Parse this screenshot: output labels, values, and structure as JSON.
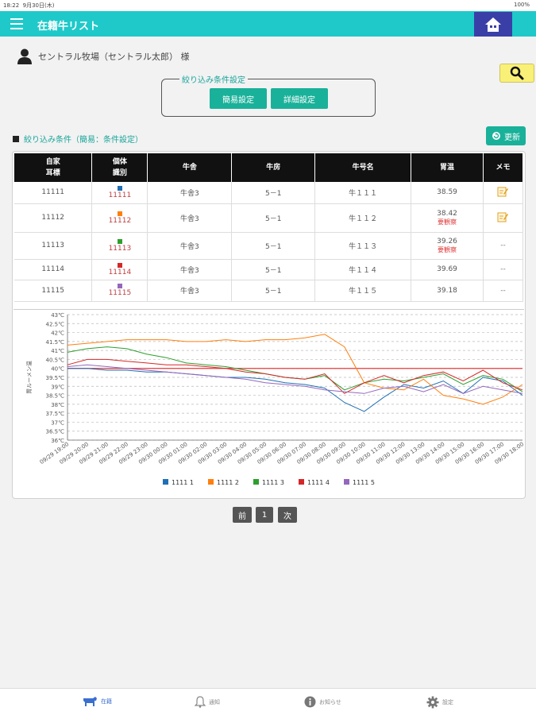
{
  "status": {
    "time": "18:22",
    "date": "9月30日(木)",
    "battery": "100%"
  },
  "header": {
    "title": "在籍牛リスト"
  },
  "user": {
    "name": "セントラル牧場（セントラル太郎） 様"
  },
  "filter": {
    "legend": "絞り込み条件設定",
    "simple_label": "簡易設定",
    "detail_label": "詳細設定"
  },
  "condition": {
    "label": "絞り込み条件（簡易：条件設定）"
  },
  "refresh": {
    "label": "更新"
  },
  "table": {
    "headers": [
      {
        "l1": "自家",
        "l2": "耳標"
      },
      {
        "l1": "個体",
        "l2": "識別"
      },
      {
        "l1": "牛舎",
        "l2": ""
      },
      {
        "l1": "牛房",
        "l2": ""
      },
      {
        "l1": "牛号名",
        "l2": ""
      },
      {
        "l1": "胃温",
        "l2": ""
      },
      {
        "l1": "メモ",
        "l2": ""
      }
    ],
    "rows": [
      {
        "own_tag": "11111",
        "id_color": "#1f6fb4",
        "id_text": "11111",
        "barn": "牛舎3",
        "pen": "5－1",
        "name": "牛１１１",
        "temp": "38.59",
        "warn": "",
        "memo": "memo-icon",
        "memo_text": ""
      },
      {
        "own_tag": "11112",
        "id_color": "#ff7f0e",
        "id_text": "11112",
        "barn": "牛舎3",
        "pen": "5－1",
        "name": "牛１１２",
        "temp": "38.42",
        "warn": "要観察",
        "memo": "memo-icon",
        "memo_text": ""
      },
      {
        "own_tag": "11113",
        "id_color": "#2ca02c",
        "id_text": "11113",
        "barn": "牛舎3",
        "pen": "5－1",
        "name": "牛１１３",
        "temp": "39.26",
        "warn": "要観察",
        "memo": "",
        "memo_text": "--"
      },
      {
        "own_tag": "11114",
        "id_color": "#d62728",
        "id_text": "11114",
        "barn": "牛舎3",
        "pen": "5－1",
        "name": "牛１１４",
        "temp": "39.69",
        "warn": "",
        "memo": "",
        "memo_text": "--"
      },
      {
        "own_tag": "11115",
        "id_color": "#9467bd",
        "id_text": "11115",
        "barn": "牛舎3",
        "pen": "5－1",
        "name": "牛１１５",
        "temp": "39.18",
        "warn": "",
        "memo": "",
        "memo_text": "--"
      }
    ]
  },
  "chart_data": {
    "type": "line",
    "ylabel": "胃ルーメン温",
    "ylim": [
      36,
      43
    ],
    "yticks": [
      "36℃",
      "36.5℃",
      "37℃",
      "37.5℃",
      "38℃",
      "38.5℃",
      "39℃",
      "39.5℃",
      "40℃",
      "40.5℃",
      "41℃",
      "41.5℃",
      "42℃",
      "42.5℃",
      "43℃"
    ],
    "xticks": [
      "09/29 19:00",
      "09/29 20:00",
      "09/29 21:00",
      "09/29 22:00",
      "09/29 23:00",
      "09/30 00:00",
      "09/30 01:00",
      "09/30 02:00",
      "09/30 03:00",
      "09/30 04:00",
      "09/30 05:00",
      "09/30 06:00",
      "09/30 07:00",
      "09/30 08:00",
      "09/30 09:00",
      "09/30 10:00",
      "09/30 11:00",
      "09/30 12:00",
      "09/30 13:00",
      "09/30 14:00",
      "09/30 15:00",
      "09/30 16:00",
      "09/30 17:00",
      "09/30 18:00"
    ],
    "threshold": 40.0,
    "threshold_color": "#e23c3c",
    "series": [
      {
        "name": "1111 1",
        "color": "#1f6fb4",
        "values": [
          40.0,
          40.0,
          39.9,
          39.9,
          39.8,
          39.8,
          39.7,
          39.6,
          39.5,
          39.5,
          39.4,
          39.2,
          39.1,
          38.9,
          38.1,
          37.6,
          38.4,
          39.1,
          38.9,
          39.3,
          38.6,
          39.5,
          39.3,
          38.5
        ]
      },
      {
        "name": "1111 2",
        "color": "#ff7f0e",
        "values": [
          41.3,
          41.4,
          41.5,
          41.6,
          41.6,
          41.6,
          41.5,
          41.5,
          41.6,
          41.5,
          41.6,
          41.6,
          41.7,
          41.9,
          41.2,
          39.2,
          38.9,
          38.8,
          39.4,
          38.5,
          38.3,
          38.0,
          38.4,
          39.1
        ]
      },
      {
        "name": "1111 3",
        "color": "#2ca02c",
        "values": [
          40.9,
          41.1,
          41.2,
          41.1,
          40.8,
          40.6,
          40.3,
          40.2,
          40.1,
          39.9,
          39.7,
          39.5,
          39.4,
          39.6,
          38.8,
          39.2,
          39.4,
          39.3,
          39.5,
          39.7,
          39.1,
          39.6,
          39.4,
          38.7
        ]
      },
      {
        "name": "1111 4",
        "color": "#d62728",
        "values": [
          40.2,
          40.5,
          40.5,
          40.4,
          40.3,
          40.2,
          40.2,
          40.1,
          40.0,
          39.8,
          39.7,
          39.5,
          39.4,
          39.7,
          38.6,
          39.2,
          39.6,
          39.2,
          39.6,
          39.8,
          39.3,
          39.9,
          39.2,
          38.8
        ]
      },
      {
        "name": "1111 5",
        "color": "#9467bd",
        "values": [
          40.1,
          40.2,
          40.1,
          40.0,
          39.9,
          39.8,
          39.7,
          39.6,
          39.5,
          39.4,
          39.2,
          39.1,
          39.0,
          38.8,
          38.7,
          38.6,
          38.9,
          39.0,
          38.7,
          39.1,
          38.6,
          39.0,
          38.8,
          38.6
        ]
      }
    ]
  },
  "pager": {
    "prev": "前",
    "page": "1",
    "next": "次"
  },
  "nav": {
    "cattle": "在籍",
    "notify": "通知",
    "info": "お知らせ",
    "settings": "設定"
  }
}
